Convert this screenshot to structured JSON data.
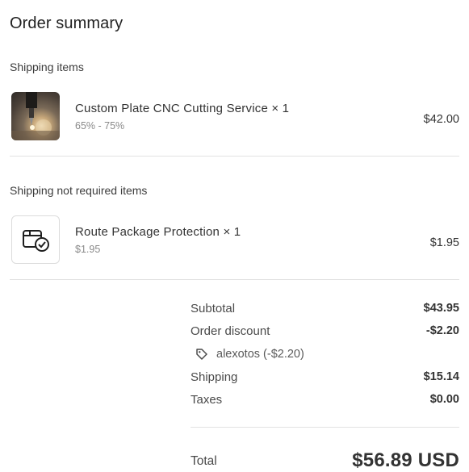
{
  "order": {
    "title": "Order summary",
    "shipping_section": {
      "label": "Shipping items",
      "items": [
        {
          "name": "Custom Plate CNC Cutting Service × 1",
          "variant": "65% - 75%",
          "price": "$42.00",
          "thumbnail": "cnc-cutting-photo"
        }
      ]
    },
    "non_shipping_section": {
      "label": "Shipping not required items",
      "items": [
        {
          "name": "Route Package Protection × 1",
          "variant": "$1.95",
          "price": "$1.95",
          "thumbnail": "package-protection-icon"
        }
      ]
    },
    "totals": {
      "subtotal_label": "Subtotal",
      "subtotal_value": "$43.95",
      "discount_label": "Order discount",
      "discount_value": "-$2.20",
      "discount_code": "alexotos (-$2.20)",
      "discount_code_icon": "tag-icon",
      "shipping_label": "Shipping",
      "shipping_value": "$15.14",
      "taxes_label": "Taxes",
      "taxes_value": "$0.00",
      "total_label": "Total",
      "total_value": "$56.89 USD"
    }
  }
}
